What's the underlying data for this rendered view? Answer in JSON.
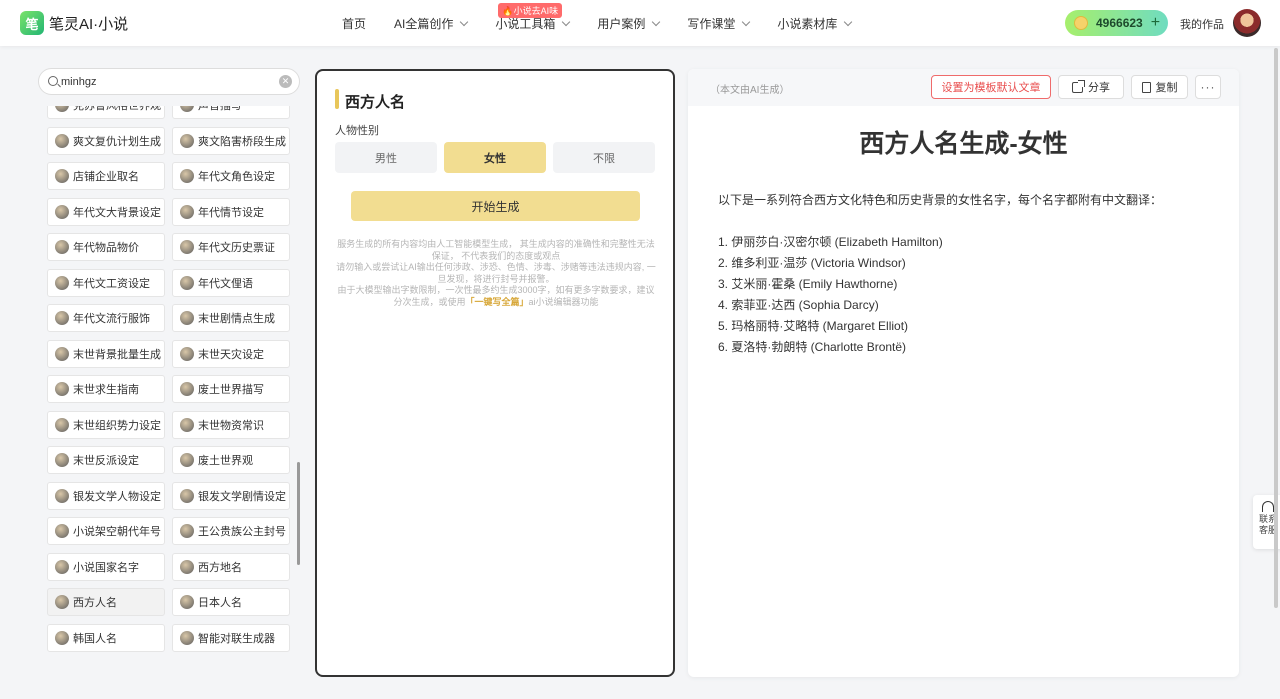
{
  "header": {
    "logo_mark": "笔",
    "logo_text": "笔灵AI·小说",
    "nav": [
      {
        "label": "首页"
      },
      {
        "label": "AI全篇创作"
      },
      {
        "label": "小说工具箱",
        "badge": "🔥小说去AI味"
      },
      {
        "label": "用户案例"
      },
      {
        "label": "写作课堂"
      },
      {
        "label": "小说素材库"
      }
    ],
    "credits": "4966623",
    "credits_plus": "+",
    "my_works": "我的作品"
  },
  "sidebar": {
    "search": {
      "value": "minhgz",
      "placeholder": ""
    },
    "clear": "✕",
    "tools": [
      "克苏鲁风格世界观",
      "声音描写",
      "爽文复仇计划生成",
      "爽文陷害桥段生成",
      "店铺企业取名",
      "年代文角色设定",
      "年代文大背景设定",
      "年代情节设定",
      "年代物品物价",
      "年代文历史票证",
      "年代文工资设定",
      "年代文俚语",
      "年代文流行服饰",
      "末世剧情点生成",
      "末世背景批量生成",
      "末世天灾设定",
      "末世求生指南",
      "废土世界描写",
      "末世组织势力设定",
      "末世物资常识",
      "末世反派设定",
      "废土世界观",
      "银发文学人物设定",
      "银发文学剧情设定",
      "小说架空朝代年号",
      "王公贵族公主封号",
      "小说国家名字",
      "西方地名",
      "西方人名",
      "日本人名",
      "韩国人名",
      "智能对联生成器"
    ],
    "active_tool": "西方人名"
  },
  "form": {
    "title": "西方人名",
    "gender_label": "人物性别",
    "gender_options": [
      "男性",
      "女性",
      "不限"
    ],
    "selected_gender": "女性",
    "start_button": "开始生成",
    "disclaimer_1": "服务生成的所有内容均由人工智能模型生成， 其生成内容的准确性和完整性无法保证， 不代表我们的态度或观点",
    "disclaimer_2": "请勿输入或尝试让AI输出任何涉政、涉恐、色情、涉毒、涉赌等违法违规内容, 一旦发现，将进行封号并报警。",
    "disclaimer_3_pre": "由于大模型输出字数限制，一次性最多约生成3000字，如有更多字数要求，建议分次生成，或使用",
    "disclaimer_3_link": "「一键写全篇」",
    "disclaimer_3_post": "ai小说编辑器功能"
  },
  "result": {
    "ai_note": "（本文由AI生成）",
    "template_button": "设置为模板默认文章",
    "share_button": "分享",
    "copy_button": "复制",
    "more_button": "···",
    "title": "西方人名生成-女性",
    "intro": "以下是一系列符合西方文化特色和历史背景的女性名字，每个名字都附有中文翻译：",
    "names": [
      "1. 伊丽莎白·汉密尔顿 (Elizabeth Hamilton)",
      "2. 维多利亚·温莎 (Victoria Windsor)",
      "3. 艾米丽·霍桑 (Emily Hawthorne)",
      "4. 索菲亚·达西 (Sophia Darcy)",
      "5. 玛格丽特·艾略特 (Margaret Elliot)",
      "6. 夏洛特·勃朗特 (Charlotte Brontë)"
    ]
  },
  "contact": {
    "label": "联系客服"
  },
  "colors": {
    "accent": "#f2dd91",
    "brand_green": "#22b573",
    "danger": "#e94f4f"
  }
}
